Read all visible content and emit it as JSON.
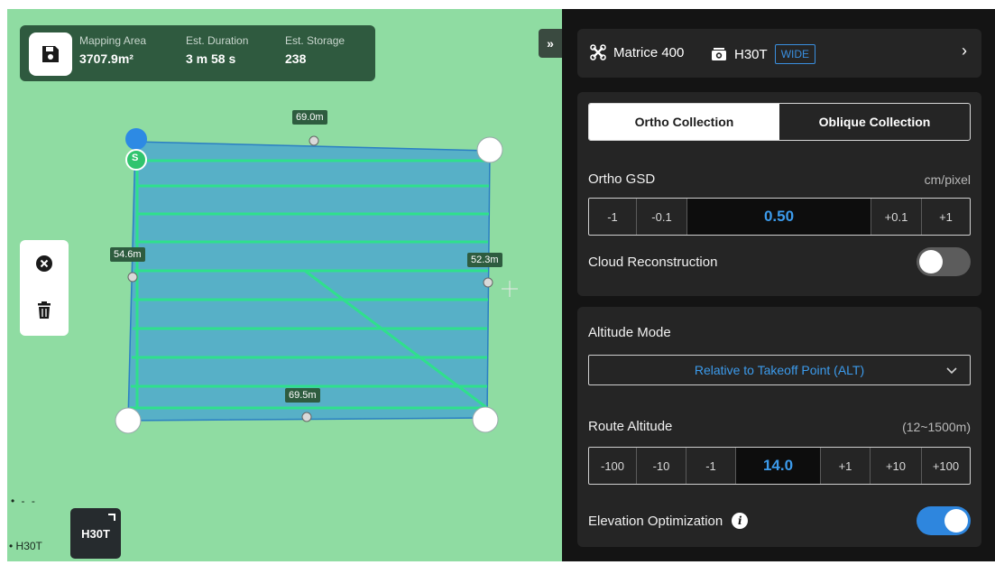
{
  "stats": {
    "mapping_area_label": "Mapping Area",
    "mapping_area_value": "3707.9m²",
    "duration_label": "Est. Duration",
    "duration_value": "3 m 58 s",
    "storage_label": "Est. Storage",
    "storage_value": "238"
  },
  "map": {
    "top_length": "69.0m",
    "left_length": "54.6m",
    "right_length": "52.3m",
    "bottom_length": "69.5m",
    "start_marker": "S",
    "camera_button": "H30T",
    "legend_camera": "• H30T",
    "legend_dashes": "• - -",
    "collapse_glyph": "»"
  },
  "device": {
    "aircraft": "Matrice 400",
    "camera": "H30T",
    "lens": "WIDE",
    "more_glyph": "›"
  },
  "collection": {
    "options": [
      "Ortho Collection",
      "Oblique Collection"
    ],
    "selected": "Ortho Collection"
  },
  "gsd": {
    "label": "Ortho GSD",
    "unit": "cm/pixel",
    "minus_buttons": [
      "-1",
      "-0.1"
    ],
    "value": "0.50",
    "plus_buttons": [
      "+0.1",
      "+1"
    ]
  },
  "cloud": {
    "label": "Cloud Reconstruction",
    "enabled": false
  },
  "altitude_mode": {
    "label": "Altitude Mode",
    "value": "Relative to Takeoff Point (ALT)"
  },
  "route_altitude": {
    "label": "Route Altitude",
    "range": "(12~1500m)",
    "minus_buttons": [
      "-100",
      "-10",
      "-1"
    ],
    "value": "14.0",
    "plus_buttons": [
      "+1",
      "+10",
      "+100"
    ]
  },
  "elevation": {
    "label": "Elevation Optimization",
    "info_glyph": "i",
    "enabled": true
  },
  "colors": {
    "map_bg": "#8fdca2",
    "polygon_fill": "#4aa6cf",
    "route_line": "#2fe08c",
    "accent_blue": "#3c9bec",
    "panel_bg": "#141414"
  },
  "icons": {
    "save": "save-icon",
    "clear": "close-circle-icon",
    "delete": "trash-icon",
    "drone": "drone-icon",
    "camera": "camera-icon"
  }
}
